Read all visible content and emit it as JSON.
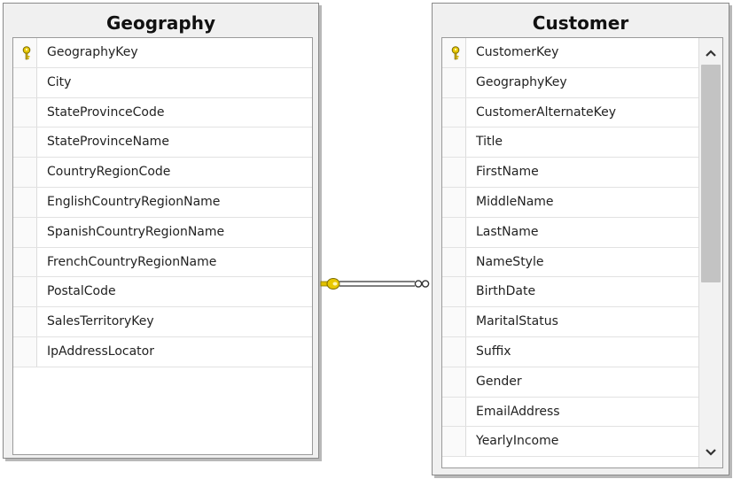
{
  "geography": {
    "title": "Geography",
    "columns": [
      {
        "name": "GeographyKey",
        "primary_key": true
      },
      {
        "name": "City",
        "primary_key": false
      },
      {
        "name": "StateProvinceCode",
        "primary_key": false
      },
      {
        "name": "StateProvinceName",
        "primary_key": false
      },
      {
        "name": "CountryRegionCode",
        "primary_key": false
      },
      {
        "name": "EnglishCountryRegionName",
        "primary_key": false
      },
      {
        "name": "SpanishCountryRegionName",
        "primary_key": false
      },
      {
        "name": "FrenchCountryRegionName",
        "primary_key": false
      },
      {
        "name": "PostalCode",
        "primary_key": false
      },
      {
        "name": "SalesTerritoryKey",
        "primary_key": false
      },
      {
        "name": "IpAddressLocator",
        "primary_key": false
      }
    ]
  },
  "customer": {
    "title": "Customer",
    "columns": [
      {
        "name": "CustomerKey",
        "primary_key": true
      },
      {
        "name": "GeographyKey",
        "primary_key": false
      },
      {
        "name": "CustomerAlternateKey",
        "primary_key": false
      },
      {
        "name": "Title",
        "primary_key": false
      },
      {
        "name": "FirstName",
        "primary_key": false
      },
      {
        "name": "MiddleName",
        "primary_key": false
      },
      {
        "name": "LastName",
        "primary_key": false
      },
      {
        "name": "NameStyle",
        "primary_key": false
      },
      {
        "name": "BirthDate",
        "primary_key": false
      },
      {
        "name": "MaritalStatus",
        "primary_key": false
      },
      {
        "name": "Suffix",
        "primary_key": false
      },
      {
        "name": "Gender",
        "primary_key": false
      },
      {
        "name": "EmailAddress",
        "primary_key": false
      },
      {
        "name": "YearlyIncome",
        "primary_key": false
      }
    ]
  },
  "icons": {
    "primary_key": "key-icon",
    "scroll_up": "chevron-up-icon",
    "scroll_down": "chevron-down-icon",
    "relationship_one": "key-connector-icon",
    "relationship_many": "infinity-connector-icon"
  },
  "colors": {
    "key_gold": "#e0c000",
    "connector": "#555555"
  }
}
